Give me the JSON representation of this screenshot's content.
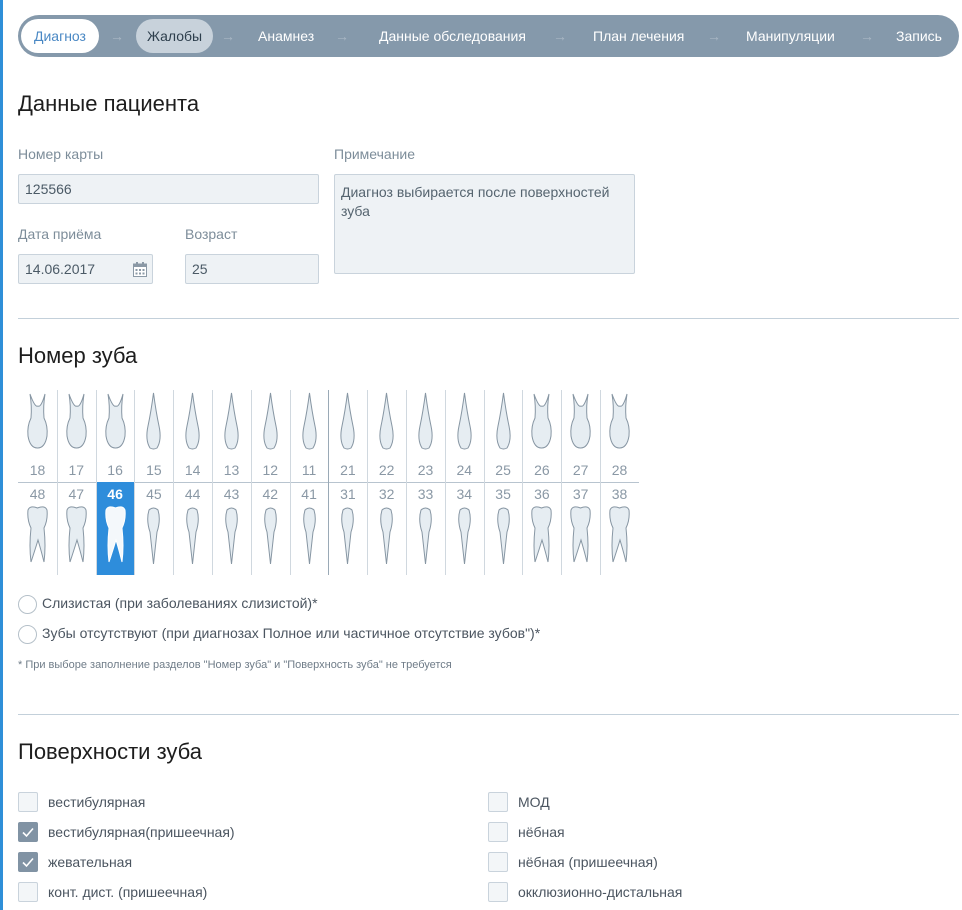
{
  "stepper": {
    "steps": [
      "Диагноз",
      "Жалобы",
      "Анамнез",
      "Данные обследования",
      "План лечения",
      "Манипуляции",
      "Запись"
    ],
    "arrow": "→"
  },
  "patient": {
    "title": "Данные пациента",
    "card_label": "Номер карты",
    "card_value": "125566",
    "note_label": "Примечание",
    "note_value": "Диагноз выбирается после поверхностей зуба",
    "date_label": "Дата приёма",
    "date_value": "14.06.2017",
    "age_label": "Возраст",
    "age_value": "25"
  },
  "teeth": {
    "title": "Номер зуба",
    "upper": [
      "18",
      "17",
      "16",
      "15",
      "14",
      "13",
      "12",
      "11",
      "21",
      "22",
      "23",
      "24",
      "25",
      "26",
      "27",
      "28"
    ],
    "lower": [
      "48",
      "47",
      "46",
      "45",
      "44",
      "43",
      "42",
      "41",
      "31",
      "32",
      "33",
      "34",
      "35",
      "36",
      "37",
      "38"
    ],
    "selected": "46",
    "option_mucosa": "Слизистая (при заболеваниях слизистой)*",
    "option_missing": "Зубы отсутствуют (при диагнозах Полное или частичное отсутствие зубов\")*",
    "footnote": "* При выборе заполнение разделов \"Номер зуба\" и \"Поверхность зуба\" не требуется"
  },
  "surfaces": {
    "title": "Поверхности зуба",
    "left": [
      {
        "label": "вестибулярная",
        "checked": false
      },
      {
        "label": "вестибулярная(пришеечная)",
        "checked": true
      },
      {
        "label": "жевательная",
        "checked": true
      },
      {
        "label": "конт. дист. (пришеечная)",
        "checked": false
      }
    ],
    "right": [
      {
        "label": "МОД",
        "checked": false
      },
      {
        "label": "нёбная",
        "checked": false
      },
      {
        "label": "нёбная (пришеечная)",
        "checked": false
      },
      {
        "label": "окклюзионно-дистальная",
        "checked": false
      }
    ]
  },
  "colors": {
    "accent": "#2e8ddb",
    "stepper_bg": "#8599ab",
    "checked": "#8193a4"
  }
}
